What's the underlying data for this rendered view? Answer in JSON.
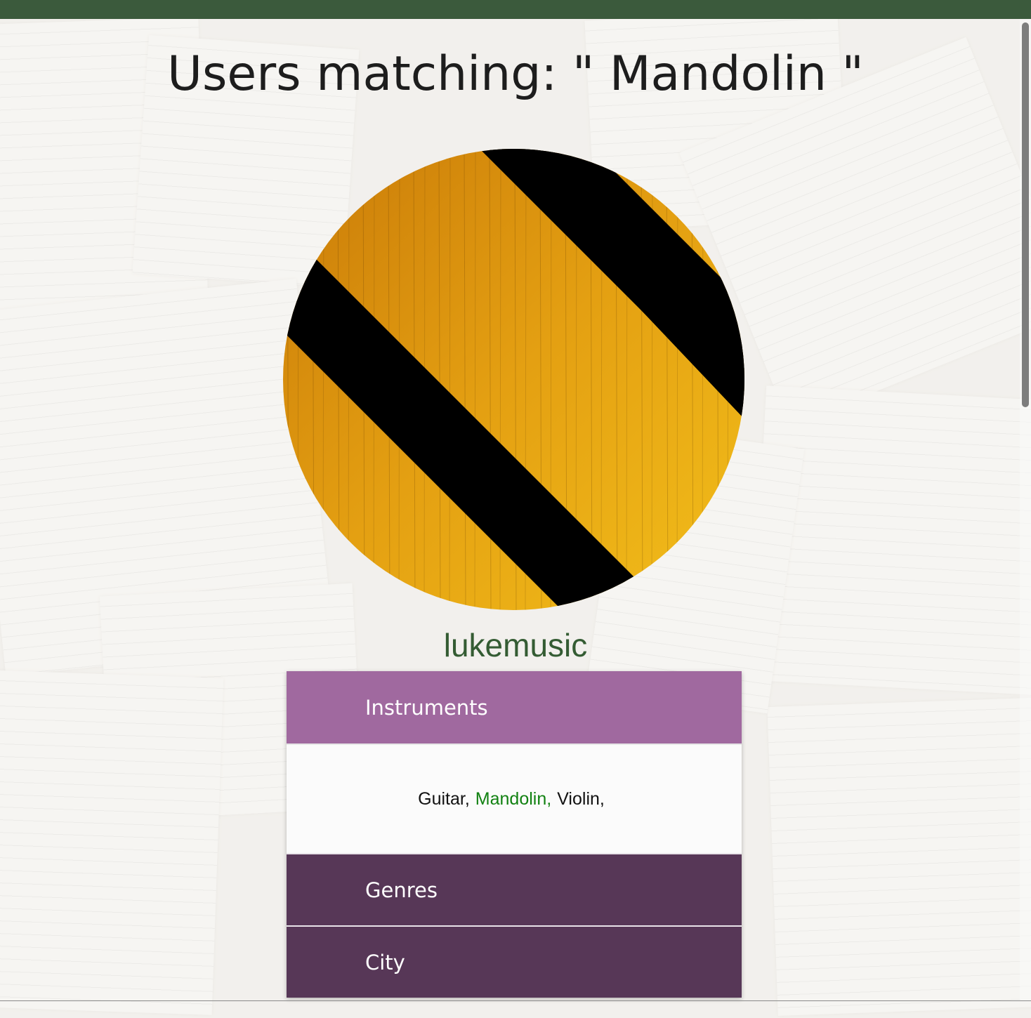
{
  "page": {
    "title": "Users matching: \" Mandolin \"",
    "search_term": "Mandolin"
  },
  "user": {
    "username": "lukemusic",
    "avatar": "striped-yellow-black-avatar"
  },
  "accordion": {
    "sections": [
      {
        "label": "Instruments",
        "expanded": true,
        "items": [
          "Guitar,",
          "Mandolin,",
          "Violin,"
        ],
        "matched_item": "Mandolin,"
      },
      {
        "label": "Genres",
        "expanded": false
      },
      {
        "label": "City",
        "expanded": false
      }
    ]
  },
  "colors": {
    "topbar": "#3b5a3c",
    "username": "#345c33",
    "active_header": "#a0699f",
    "collapsed_header": "#573757",
    "match_text": "#118111",
    "avatar_stripe_yellow": "#e9a11a",
    "avatar_stripe_black": "#000000"
  }
}
